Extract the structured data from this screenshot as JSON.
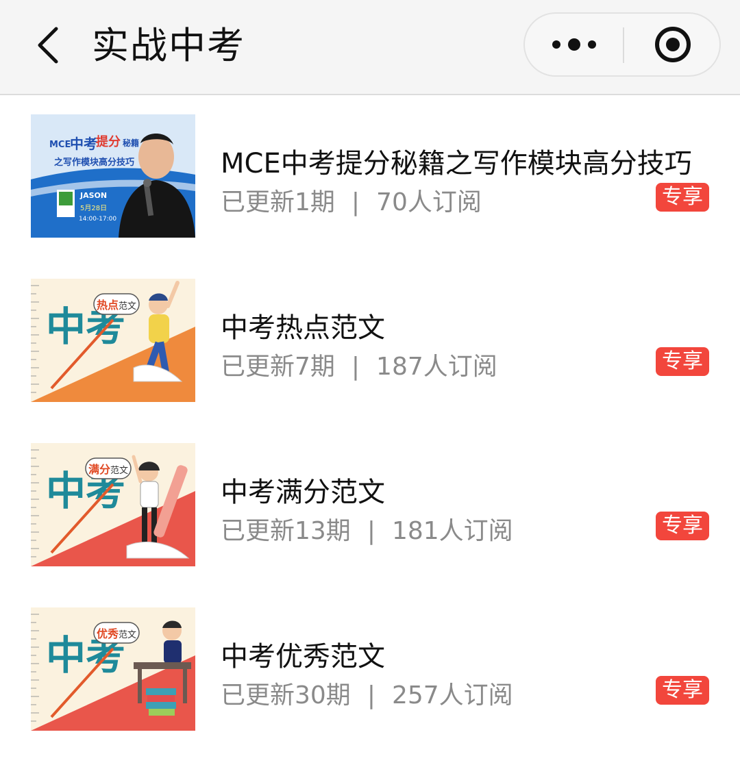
{
  "header": {
    "title": "实战中考",
    "back_icon": "chevron-left-icon",
    "more_icon": "more-dots-icon",
    "close_icon": "target-close-icon"
  },
  "colors": {
    "badge": "#f2463c",
    "topbar_bg": "#f5f5f5",
    "meta_text": "#8a8a8a"
  },
  "items": [
    {
      "title": "MCE中考提分秘籍之写作模块高分技巧",
      "updated": "已更新1期",
      "subscribers": "70人订阅",
      "badge": "专享",
      "thumb": {
        "line1_a": "MCE",
        "line1_b": "中考",
        "line1_c": "提分",
        "line1_d": "秘籍",
        "line2": "之写作模块高分技巧",
        "name": "JASON",
        "date": "5月28日",
        "time": "14:00-17:00"
      }
    },
    {
      "title": "中考热点范文",
      "updated": "已更新7期",
      "subscribers": "187人订阅",
      "badge": "专享",
      "thumb": {
        "big": "中考",
        "tag_a": "热点",
        "tag_b": "范文"
      }
    },
    {
      "title": "中考满分范文",
      "updated": "已更新13期",
      "subscribers": "181人订阅",
      "badge": "专享",
      "thumb": {
        "big": "中考",
        "tag_a": "满分",
        "tag_b": "范文"
      }
    },
    {
      "title": "中考优秀范文",
      "updated": "已更新30期",
      "subscribers": "257人订阅",
      "badge": "专享",
      "thumb": {
        "big": "中考",
        "tag_a": "优秀",
        "tag_b": "范文"
      }
    }
  ]
}
